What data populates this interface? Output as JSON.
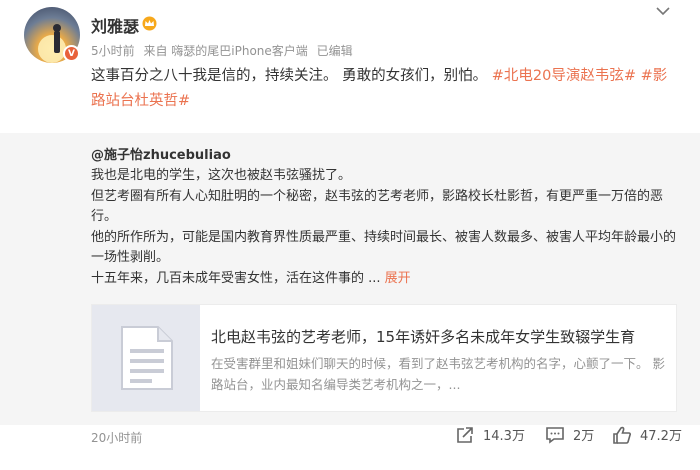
{
  "post": {
    "author": "刘雅瑟",
    "verified_badge": "V",
    "time": "5小时前",
    "source": "来自 嗨瑟的尾巴iPhone客户端",
    "edited": "已编辑",
    "text_prefix": "这事百分之八十我是信的，持续关注。 勇敢的女孩们，别怕。",
    "tag1": "#北电20导演赵韦弦#",
    "tag2": "#影路站台杜英哲#"
  },
  "repost": {
    "author": "@施子怡zhucebuliao",
    "lines": [
      "我也是北电的学生，这次也被赵韦弦骚扰了。",
      "但艺考圈有所有人心知肚明的一个秘密，赵韦弦的艺考老师，影路校长杜影哲，有更严重一万倍的恶行。",
      "他的所作所为，可能是国内教育界性质最严重、持续时间最长、被害人数最多、被害人平均年龄最小的一场性剥削。"
    ],
    "last_line": "十五年来，几百未成年受害女性，活在这件事的 ...",
    "expand": "展开",
    "card": {
      "title": "北电赵韦弦的艺考老师，15年诱奸多名未成年女学生致辍学生育",
      "desc": "在受害群里和姐妹们聊天的时候，看到了赵韦弦艺考机构的名字，心颤了一下。 影路站台，业内最知名编导类艺考机构之一，..."
    },
    "time": "20小时前",
    "shares": "14.3万",
    "comments": "2万",
    "likes": "47.2万"
  },
  "colors": {
    "accent": "#eb7350",
    "muted": "#939393",
    "repost_bg": "#f5f5f5"
  },
  "icons": [
    "crown-icon",
    "chevron-down-icon",
    "share-icon",
    "comment-icon",
    "like-icon",
    "document-icon"
  ]
}
